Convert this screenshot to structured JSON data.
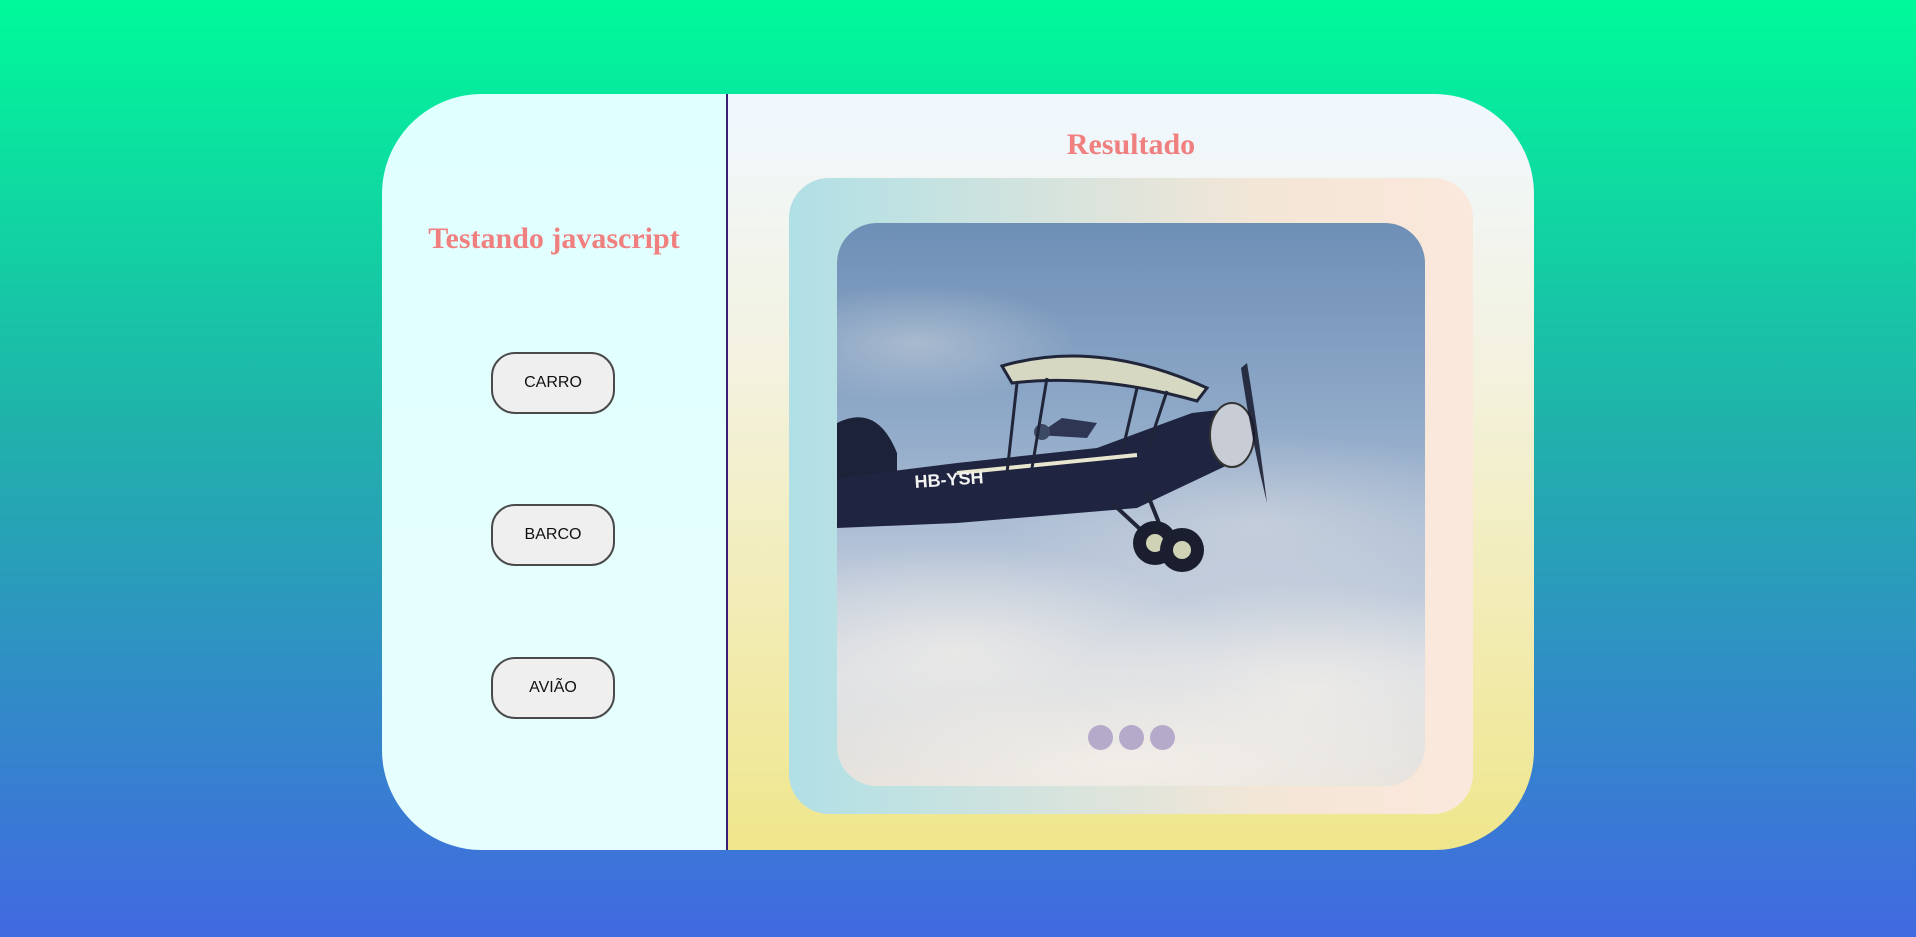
{
  "left": {
    "title": "Testando javascript",
    "buttons": [
      "CARRO",
      "BARCO",
      "AVIÃO"
    ]
  },
  "right": {
    "title": "Resultado",
    "slide": {
      "image_subject": "biplane",
      "registration": "HB-YSH"
    },
    "slider_dots": 3
  },
  "colors": {
    "title_color": "#f08080",
    "divider": "#3b1f7a",
    "dot": "#ab9fc4"
  }
}
